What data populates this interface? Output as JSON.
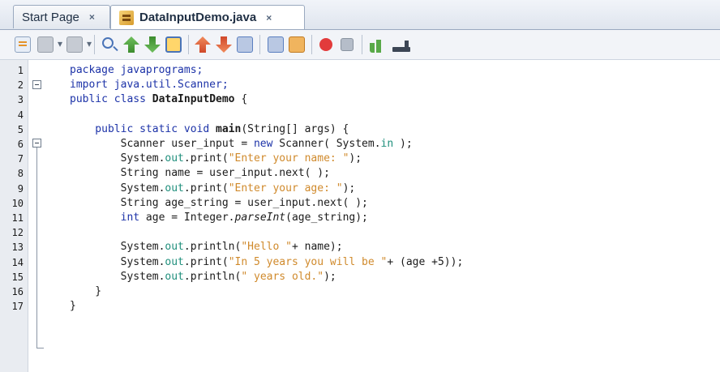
{
  "tabs": [
    {
      "label": "Start Page",
      "close": "×"
    },
    {
      "label": "DataInputDemo.java",
      "close": "×"
    }
  ],
  "toolbar": {
    "icons": [
      "source-history-icon",
      "editor-icon",
      "back-icon",
      "forward-icon",
      "find-icon",
      "find-previous-icon",
      "find-next-icon",
      "toggle-highlight-icon",
      "shift-line-left-icon",
      "shift-line-right-icon",
      "toggle-bookmark-icon",
      "comment-icon",
      "uncomment-icon",
      "record-macro-icon",
      "stop-macro-icon",
      "diff-icon",
      "history-icon"
    ]
  },
  "editor": {
    "line_numbers": [
      "1",
      "2",
      "3",
      "4",
      "5",
      "6",
      "7",
      "8",
      "9",
      "10",
      "11",
      "12",
      "13",
      "14",
      "15",
      "16",
      "17"
    ],
    "lines": [
      [
        {
          "t": "package javaprograms;",
          "c": "kw"
        }
      ],
      [
        {
          "t": "import java.util.Scanner;",
          "c": "kw"
        }
      ],
      [
        {
          "t": "public class ",
          "c": "kw"
        },
        {
          "t": "DataInputDemo",
          "c": "bold"
        },
        {
          "t": " {",
          "c": ""
        }
      ],
      [],
      [
        {
          "t": "    public static void ",
          "c": "kw"
        },
        {
          "t": "main",
          "c": "bold"
        },
        {
          "t": "(String[] args) {",
          "c": ""
        }
      ],
      [
        {
          "t": "        Scanner user_input = ",
          "c": ""
        },
        {
          "t": "new",
          "c": "kw"
        },
        {
          "t": " Scanner( System.",
          "c": ""
        },
        {
          "t": "in",
          "c": "field"
        },
        {
          "t": " );",
          "c": ""
        }
      ],
      [
        {
          "t": "        System.",
          "c": ""
        },
        {
          "t": "out",
          "c": "field"
        },
        {
          "t": ".print(",
          "c": ""
        },
        {
          "t": "\"Enter your name: \"",
          "c": "str"
        },
        {
          "t": ");",
          "c": ""
        }
      ],
      [
        {
          "t": "        String name = user_input.next( );",
          "c": ""
        }
      ],
      [
        {
          "t": "        System.",
          "c": ""
        },
        {
          "t": "out",
          "c": "field"
        },
        {
          "t": ".print(",
          "c": ""
        },
        {
          "t": "\"Enter your age: \"",
          "c": "str"
        },
        {
          "t": ");",
          "c": ""
        }
      ],
      [
        {
          "t": "        String age_string = user_input.next( );",
          "c": ""
        }
      ],
      [
        {
          "t": "        ",
          "c": ""
        },
        {
          "t": "int",
          "c": "kw"
        },
        {
          "t": " age = Integer.",
          "c": ""
        },
        {
          "t": "parseInt",
          "c": "italic"
        },
        {
          "t": "(age_string);",
          "c": ""
        }
      ],
      [],
      [
        {
          "t": "        System.",
          "c": ""
        },
        {
          "t": "out",
          "c": "field"
        },
        {
          "t": ".println(",
          "c": ""
        },
        {
          "t": "\"Hello \"",
          "c": "str"
        },
        {
          "t": "+ name);",
          "c": ""
        }
      ],
      [
        {
          "t": "        System.",
          "c": ""
        },
        {
          "t": "out",
          "c": "field"
        },
        {
          "t": ".print(",
          "c": ""
        },
        {
          "t": "\"In 5 years you will be \"",
          "c": "str"
        },
        {
          "t": "+ (age +5));",
          "c": ""
        }
      ],
      [
        {
          "t": "        System.",
          "c": ""
        },
        {
          "t": "out",
          "c": "field"
        },
        {
          "t": ".println(",
          "c": ""
        },
        {
          "t": "\" years old.\"",
          "c": "str"
        },
        {
          "t": ");",
          "c": ""
        }
      ],
      [
        {
          "t": "    }",
          "c": ""
        }
      ],
      [
        {
          "t": "}",
          "c": ""
        }
      ]
    ]
  },
  "colors": {
    "keyword": "#1d33a8",
    "string": "#d08a2c",
    "field": "#1f8f7c",
    "gutter": "#e9ecf1"
  }
}
